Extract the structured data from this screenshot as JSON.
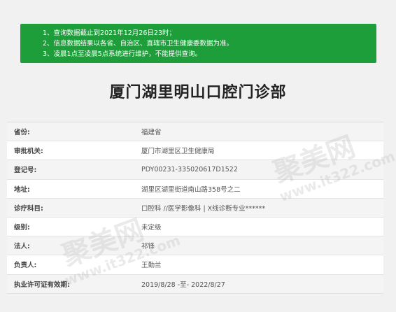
{
  "notice": {
    "lines": [
      "1、查询数据截止到2021年12月26日23时；",
      "2、信息数据结果以各省、自治区、直辖市卫生健康委数据为准。",
      "3、凌晨1点至凌晨5点系统进行维护，不能提供查询。"
    ]
  },
  "title": "厦门湖里明山口腔门诊部",
  "rows": [
    {
      "label": "省份:",
      "value": "福建省"
    },
    {
      "label": "审批机关:",
      "value": "厦门市湖里区卫生健康局"
    },
    {
      "label": "登记号:",
      "value": "PDY00231-335020617D1522"
    },
    {
      "label": "地址:",
      "value": "湖里区湖里街道南山路358号之二"
    },
    {
      "label": "诊疗科目:",
      "value": "口腔科 //医学影像科 | X线诊断专业******"
    },
    {
      "label": "级别:",
      "value": "未定级"
    },
    {
      "label": "法人:",
      "value": "祁锋"
    },
    {
      "label": "负责人:",
      "value": "王勤兰"
    },
    {
      "label": "执业许可证有效期:",
      "value": "2019/8/28 -至- 2022/8/27"
    }
  ],
  "watermark": {
    "text": "聚美网",
    "url": "www.it322.com"
  }
}
